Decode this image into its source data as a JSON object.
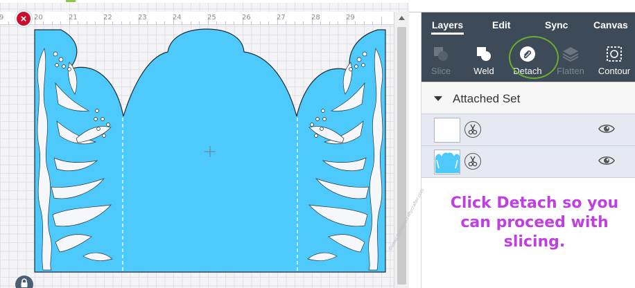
{
  "ruler": {
    "labels": [
      "9",
      "20",
      "21",
      "22",
      "23",
      "24",
      "25",
      "26",
      "27",
      "28",
      "29"
    ]
  },
  "close_badge": {
    "glyph": "×"
  },
  "tabs": [
    {
      "label": "Layers",
      "active": true
    },
    {
      "label": "Edit",
      "active": false
    },
    {
      "label": "Sync",
      "active": false
    },
    {
      "label": "Canvas",
      "active": false
    }
  ],
  "toolbar": {
    "slice": {
      "label": "Slice",
      "enabled": false
    },
    "weld": {
      "label": "Weld",
      "enabled": true
    },
    "detach": {
      "label": "Detach",
      "enabled": true
    },
    "flatten": {
      "label": "Flatten",
      "enabled": false
    },
    "contour": {
      "label": "Contour",
      "enabled": true
    }
  },
  "layers_panel": {
    "group_title": "Attached Set",
    "layers": [
      {
        "thumb": "white-rectangle",
        "visible": true
      },
      {
        "thumb": "blue-card",
        "visible": true
      }
    ]
  },
  "instruction": {
    "text": "Click Detach so you can proceed with slicing."
  },
  "watermark": {
    "text": "©www.themonzcraftycrafter.com"
  },
  "colors": {
    "design_fill": "#4ec9fb",
    "panel_dark": "#3d4a57",
    "highlight_ring": "#6cae2d",
    "instruction_text": "#c03fe0",
    "close_badge": "#c8102e"
  }
}
